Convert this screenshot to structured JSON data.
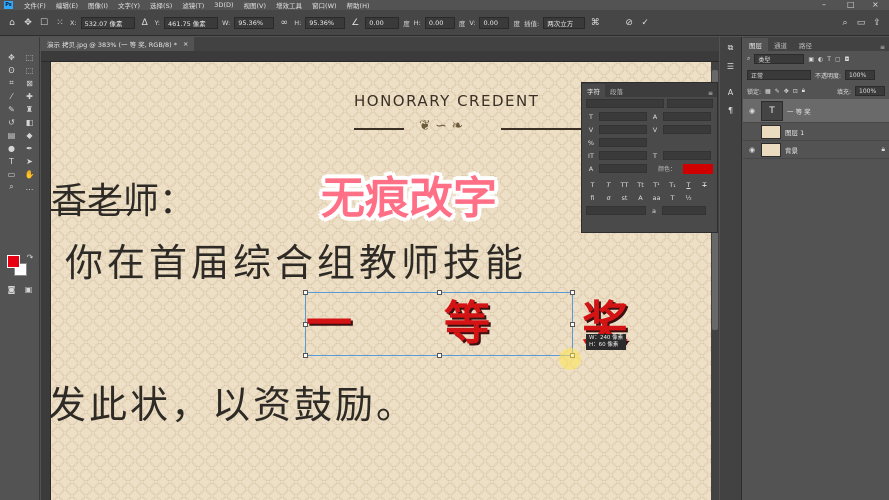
{
  "app": {
    "logo": "Ps",
    "menu": [
      "文件(F)",
      "编辑(E)",
      "图像(I)",
      "文字(Y)",
      "选择(S)",
      "滤镜(T)",
      "3D(D)",
      "视图(V)",
      "增效工具",
      "窗口(W)",
      "帮助(H)"
    ]
  },
  "options_bar": {
    "x_label": "X:",
    "x_value": "532.07 像素",
    "y_label": "Y:",
    "y_value": "461.75 像素",
    "w_label": "W:",
    "w_value": "95.36%",
    "h_label": "H:",
    "h_value": "95.36%",
    "angle_value": "0.00",
    "angle_unit": "度",
    "hskew_label": "H:",
    "hskew_value": "0.00",
    "vskew_label": "V:",
    "vskew_value": "0.00",
    "hskew_unit": "度",
    "vskew_unit": "度",
    "interp_label": "插值:",
    "interp_value": "两次立方"
  },
  "document": {
    "tab_title": "演示 拷贝.jpg @ 383% (一 等 奖, RGB/8) *",
    "tab_close": "×",
    "honor_text": "HONORARY CREDENT",
    "line1": "香老师：",
    "line2": "你在首届综合组教师技能",
    "award": "一 等 奖",
    "line4": "发此状，以资鼓励。",
    "size_w": "W：240 像素",
    "size_h": "H：60 像素",
    "watermark": "无痕改字"
  },
  "character_panel": {
    "tabs": [
      "字符",
      "段落"
    ],
    "color_label": "颜色：",
    "text_color": "#d00000"
  },
  "layers_panel": {
    "tabs": [
      "图层",
      "通道",
      "路径"
    ],
    "filter_value": "类型",
    "blend_mode": "正常",
    "opacity_label": "不透明度:",
    "opacity_value": "100%",
    "lock_label": "锁定:",
    "fill_label": "填充:",
    "fill_value": "100%",
    "layers": [
      {
        "name": "一 等 奖",
        "thumb": "T",
        "visible": true,
        "selected": true
      },
      {
        "name": "图层 1",
        "thumb": "",
        "visible": false,
        "selected": false
      },
      {
        "name": "背景",
        "thumb": "",
        "visible": true,
        "selected": false,
        "locked": true
      }
    ]
  },
  "colors": {
    "foreground": "#e60012",
    "background": "#ffffff",
    "accent": "#31a8ff"
  }
}
